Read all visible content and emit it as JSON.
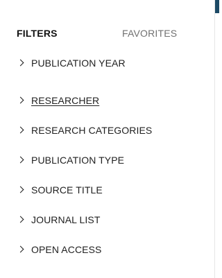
{
  "tabs": {
    "filters": "FILTERS",
    "favorites": "FAVORITES"
  },
  "filters": [
    {
      "label": "PUBLICATION YEAR",
      "expanded": false
    },
    {
      "label": "RESEARCHER",
      "expanded": false,
      "hovered": true
    },
    {
      "label": "RESEARCH CATEGORIES",
      "expanded": false
    },
    {
      "label": "PUBLICATION TYPE",
      "expanded": false
    },
    {
      "label": "SOURCE TITLE",
      "expanded": false
    },
    {
      "label": "JOURNAL LIST",
      "expanded": false
    },
    {
      "label": "OPEN ACCESS",
      "expanded": false
    }
  ],
  "colors": {
    "header_bar": "#1d4a66",
    "logo_accent": "#f2c200",
    "active_tab": "#111111",
    "inactive_tab": "#707070"
  },
  "icons": {
    "collapsed_chevron": "chevron-right-icon"
  }
}
